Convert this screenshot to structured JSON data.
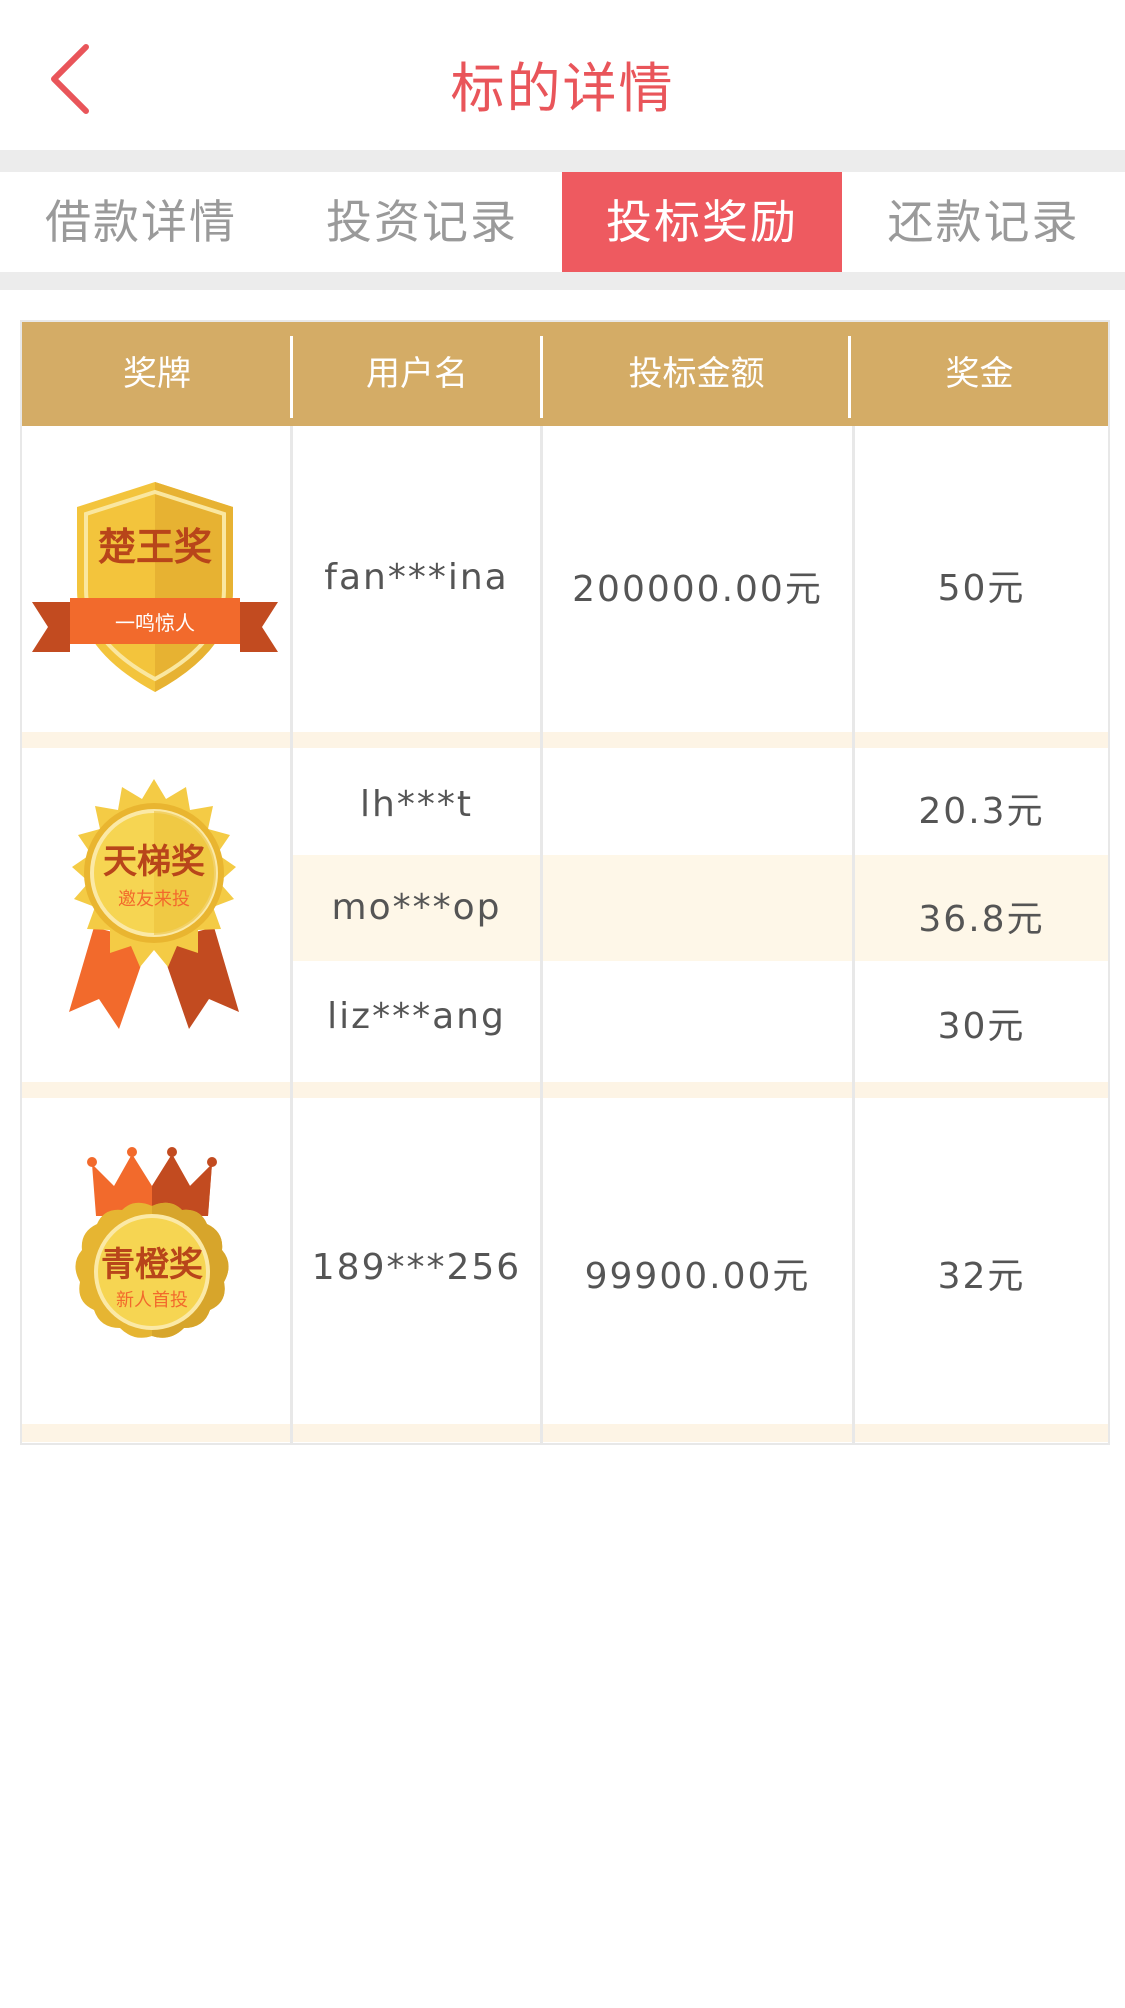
{
  "header": {
    "title": "标的详情"
  },
  "tabs": [
    {
      "label": "借款详情",
      "active": false
    },
    {
      "label": "投资记录",
      "active": false
    },
    {
      "label": "投标奖励",
      "active": true
    },
    {
      "label": "还款记录",
      "active": false
    }
  ],
  "table": {
    "headers": [
      "奖牌",
      "用户名",
      "投标金额",
      "奖金"
    ],
    "groups": [
      {
        "medal": {
          "name": "楚王奖",
          "subtitle": "一鸣惊人"
        },
        "rows": [
          {
            "username": "fan***ina",
            "amount": "200000.00元",
            "bonus": "50元"
          }
        ]
      },
      {
        "medal": {
          "name": "天梯奖",
          "subtitle": "邀友来投"
        },
        "rows": [
          {
            "username": "lh***t",
            "amount": "",
            "bonus": "20.3元"
          },
          {
            "username": "mo***op",
            "amount": "",
            "bonus": "36.8元"
          },
          {
            "username": "liz***ang",
            "amount": "",
            "bonus": "30元"
          }
        ]
      },
      {
        "medal": {
          "name": "青橙奖",
          "subtitle": "新人首投"
        },
        "rows": [
          {
            "username": "189***256",
            "amount": "99900.00元",
            "bonus": "32元"
          }
        ]
      }
    ]
  },
  "colors": {
    "accent": "#ee5a60",
    "header_gold": "#d4ac66",
    "stripe": "#fdf4e5"
  }
}
